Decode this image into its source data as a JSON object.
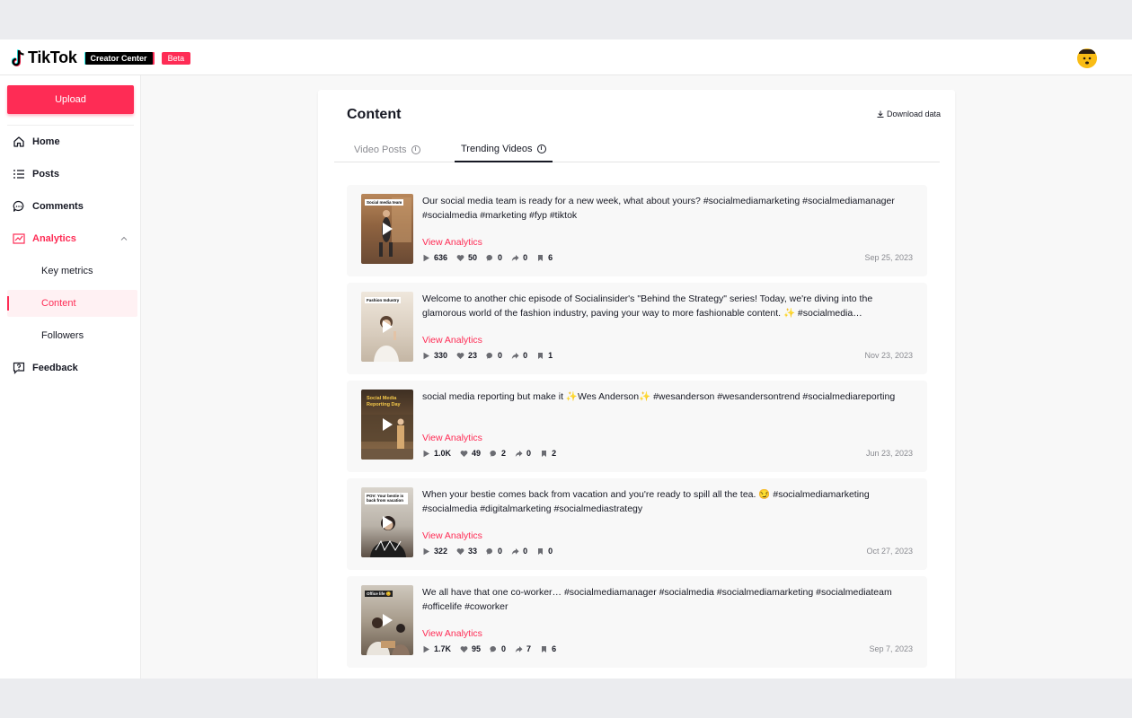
{
  "brand": {
    "name": "TikTok",
    "product": "Creator Center",
    "badge": "Beta",
    "accent": "#fe2c55"
  },
  "sidebar": {
    "upload": "Upload",
    "items": [
      {
        "label": "Home",
        "icon": "home-icon"
      },
      {
        "label": "Posts",
        "icon": "list-icon"
      },
      {
        "label": "Comments",
        "icon": "comment-icon"
      },
      {
        "label": "Analytics",
        "icon": "chart-icon",
        "expanded": true
      },
      {
        "label": "Key metrics"
      },
      {
        "label": "Content",
        "active": true
      },
      {
        "label": "Followers"
      },
      {
        "label": "Feedback",
        "icon": "feedback-icon"
      }
    ]
  },
  "main": {
    "title": "Content",
    "download": "Download data",
    "tabs": [
      {
        "label": "Video Posts",
        "active": false
      },
      {
        "label": "Trending Videos",
        "active": true
      }
    ],
    "videos": [
      {
        "thumb_label": "Social media team",
        "description": "Our social media team is ready for a new week, what about yours? #socialmediamarketing #socialmediamanager #socialmedia #marketing #fyp #tiktok",
        "action": "View Analytics",
        "views": "636",
        "likes": "50",
        "comments": "0",
        "shares": "0",
        "saves": "6",
        "date": "Sep 25, 2023"
      },
      {
        "thumb_label": "Fashion Industry",
        "description": "Welcome to another chic episode of Socialinsider's \"Behind the Strategy\" series! Today, we're diving into the glamorous world of the fashion industry, paving your way to more fashionable content. ✨ #socialmedia…",
        "action": "View Analytics",
        "views": "330",
        "likes": "23",
        "comments": "0",
        "shares": "0",
        "saves": "1",
        "date": "Nov 23, 2023"
      },
      {
        "thumb_label": "Social Media Reporting Day",
        "description": "social media reporting but make it ✨Wes Anderson✨ #wesanderson #wesandersontrend #socialmediareporting",
        "action": "View Analytics",
        "views": "1.0K",
        "likes": "49",
        "comments": "2",
        "shares": "0",
        "saves": "2",
        "date": "Jun 23, 2023"
      },
      {
        "thumb_label": "POV: Your bestie is back from vacation",
        "description": "When your bestie comes back from vacation and you're ready to spill all the tea. 😏 #socialmediamarketing #socialmedia #digitalmarketing #socialmediastrategy",
        "action": "View Analytics",
        "views": "322",
        "likes": "33",
        "comments": "0",
        "shares": "0",
        "saves": "0",
        "date": "Oct 27, 2023"
      },
      {
        "thumb_label": "Office life 😊",
        "description": "We all have that one co-worker… #socialmediamanager #socialmedia #socialmediamarketing #socialmediateam #officelife #coworker",
        "action": "View Analytics",
        "views": "1.7K",
        "likes": "95",
        "comments": "0",
        "shares": "7",
        "saves": "6",
        "date": "Sep 7, 2023"
      }
    ]
  }
}
